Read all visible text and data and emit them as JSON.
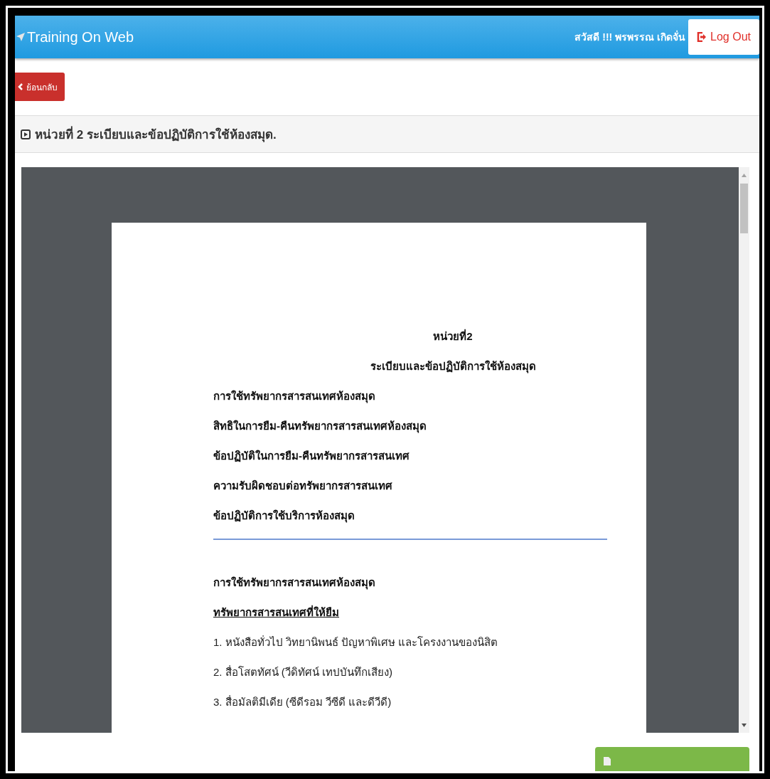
{
  "header": {
    "brand": "Training On Web",
    "greeting": "สวัสดี !!! พรพรรณ เกิดจั่น",
    "logout": "Log Out"
  },
  "back_button": "ย้อนกลับ",
  "unit_title": "หน่วยที่ 2 ระเบียบและข้อปฏิบัติการใช้ห้องสมุด.",
  "document": {
    "heading": "หน่วยที่2",
    "subheading": "ระเบียบและข้อปฏิบัติการใช้ห้องสมุด",
    "topics": [
      "การใช้ทรัพยากรสารสนเทศห้องสมุด",
      "สิทธิในการยืม-คืนทรัพยากรสารสนเทศห้องสมุด",
      "ข้อปฏิบัติในการยืม-คืนทรัพยากรสารสนเทศ",
      "ความรับผิดชอบต่อทรัพยากรสารสนเทศ",
      "ข้อปฏิบัติการใช้บริการห้องสมุด"
    ],
    "section_title": "การใช้ทรัพยากรสารสนเทศห้องสมุด",
    "section_subtitle": "ทรัพยากรสารสนเทศที่ให้ยืม",
    "items": [
      "1. หนังสือทั่วไป วิทยานิพนธ์ ปัญหาพิเศษ และโครงงานของนิสิต",
      "2. สื่อโสตทัศน์ (วีดิทัศน์ เทปบันทึกเสียง)",
      "3. สื่อมัลติมีเดีย (ซีดีรอม วีซีดี และดีวีดี)"
    ]
  }
}
